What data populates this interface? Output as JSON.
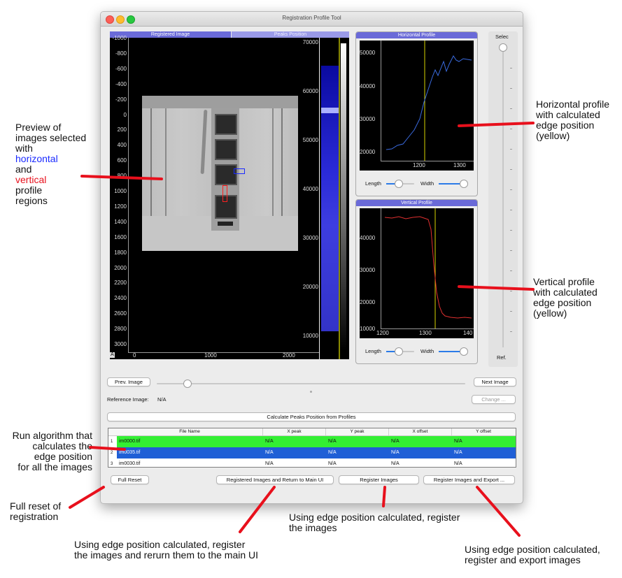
{
  "window": {
    "title": "Registration Profile Tool"
  },
  "tabs": {
    "registered": "Registered Image",
    "peaks": "Peaks Position"
  },
  "image_axes": {
    "y_ticks": [
      "-1000",
      "-800",
      "-600",
      "-400",
      "-200",
      "0",
      "200",
      "400",
      "600",
      "800",
      "1000",
      "1200",
      "1400",
      "1600",
      "1800",
      "2000",
      "2200",
      "2400",
      "2600",
      "2800",
      "3000"
    ],
    "x_ticks": [
      "0",
      "1000",
      "2000"
    ],
    "corner_badge": "A"
  },
  "histogram": {
    "ticks": [
      "70000",
      "60000",
      "50000",
      "40000",
      "30000",
      "20000",
      "10000"
    ]
  },
  "horizontal_profile": {
    "title": "Horizontal Profile",
    "y_ticks": [
      "50000",
      "40000",
      "30000",
      "20000"
    ],
    "x_ticks": [
      "1200",
      "1300"
    ],
    "length_label": "Length",
    "width_label": "Width"
  },
  "vertical_profile": {
    "title": "Vertical Profile",
    "y_ticks": [
      "40000",
      "30000",
      "20000",
      "10000"
    ],
    "x_ticks": [
      "1200",
      "1300",
      "140"
    ],
    "length_label": "Length",
    "width_label": "Width"
  },
  "side_slider": {
    "top_label": "Selec",
    "bottom_label": "Ref."
  },
  "controls": {
    "prev_image": "Prev. Image",
    "next_image": "Next Image",
    "reference_label": "Reference Image:",
    "reference_value": "N/A",
    "change": "Change ...",
    "calculate": "Calculate Peaks Position from Profiles",
    "full_reset": "Full Reset",
    "register_return": "Registered Images and Return to Main UI",
    "register": "Register Images",
    "register_export": "Register Images and Export ..."
  },
  "table": {
    "columns": [
      "File Name",
      "X peak",
      "Y peak",
      "X offset",
      "Y offset"
    ],
    "rows": [
      {
        "num": "1",
        "file": "im0000.tif",
        "xpeak": "N/A",
        "ypeak": "N/A",
        "xoff": "N/A",
        "yoff": "N/A"
      },
      {
        "num": "2",
        "file": "im0035.tif",
        "xpeak": "N/A",
        "ypeak": "N/A",
        "xoff": "N/A",
        "yoff": "N/A"
      },
      {
        "num": "3",
        "file": "im0030.tif",
        "xpeak": "N/A",
        "ypeak": "N/A",
        "xoff": "N/A",
        "yoff": "N/A"
      }
    ]
  },
  "annotations": {
    "preview": [
      "Preview of",
      "images selected",
      "with"
    ],
    "preview_h": "horizontal",
    "preview_and": "and",
    "preview_v": "vertical",
    "preview_tail": [
      "profile",
      "regions"
    ],
    "horizontal": [
      "Horizontal profile",
      "with calculated",
      "edge position",
      "(yellow)"
    ],
    "vertical": [
      "Vertical profile",
      "with calculated",
      "edge position",
      "(yellow)"
    ],
    "run_algo": [
      "Run algorithm that",
      "calculates the",
      "edge position",
      "for all the images"
    ],
    "full_reset": [
      "Full reset of",
      "registration"
    ],
    "register_return": [
      "Using edge position calculated, register",
      "the images and rerurn them to the main UI"
    ],
    "register": [
      "Using edge position calculated, register",
      "the images"
    ],
    "register_export": [
      "Using edge position calculated,",
      "register and export images"
    ]
  },
  "colors": {
    "accent_blue": "#1f5fd6",
    "row_green": "#33ef33",
    "arrow_red": "#e8101c",
    "tab_active": "#6a6ad8",
    "edge_yellow": "#d7d400"
  }
}
